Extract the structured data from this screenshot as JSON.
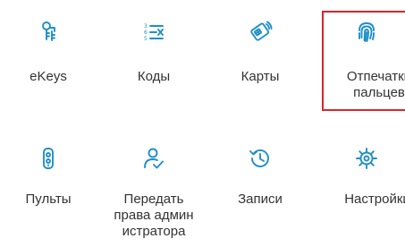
{
  "tiles": [
    {
      "label": "eKeys",
      "icon": "key-icon"
    },
    {
      "label": "Коды",
      "icon": "codes-list-icon"
    },
    {
      "label": "Карты",
      "icon": "card-icon"
    },
    {
      "label": "Отпечатки\nпальцев",
      "icon": "fingerprint-icon"
    },
    {
      "label": "Пульты",
      "icon": "remote-icon"
    },
    {
      "label": "Передать\nправа админ\nистратора",
      "icon": "transfer-admin-icon"
    },
    {
      "label": "Записи",
      "icon": "history-icon"
    },
    {
      "label": "Настройки",
      "icon": "gear-icon"
    }
  ],
  "colors": {
    "accent": "#1f8fc9",
    "highlight": "#d9242b",
    "text": "#333333"
  }
}
